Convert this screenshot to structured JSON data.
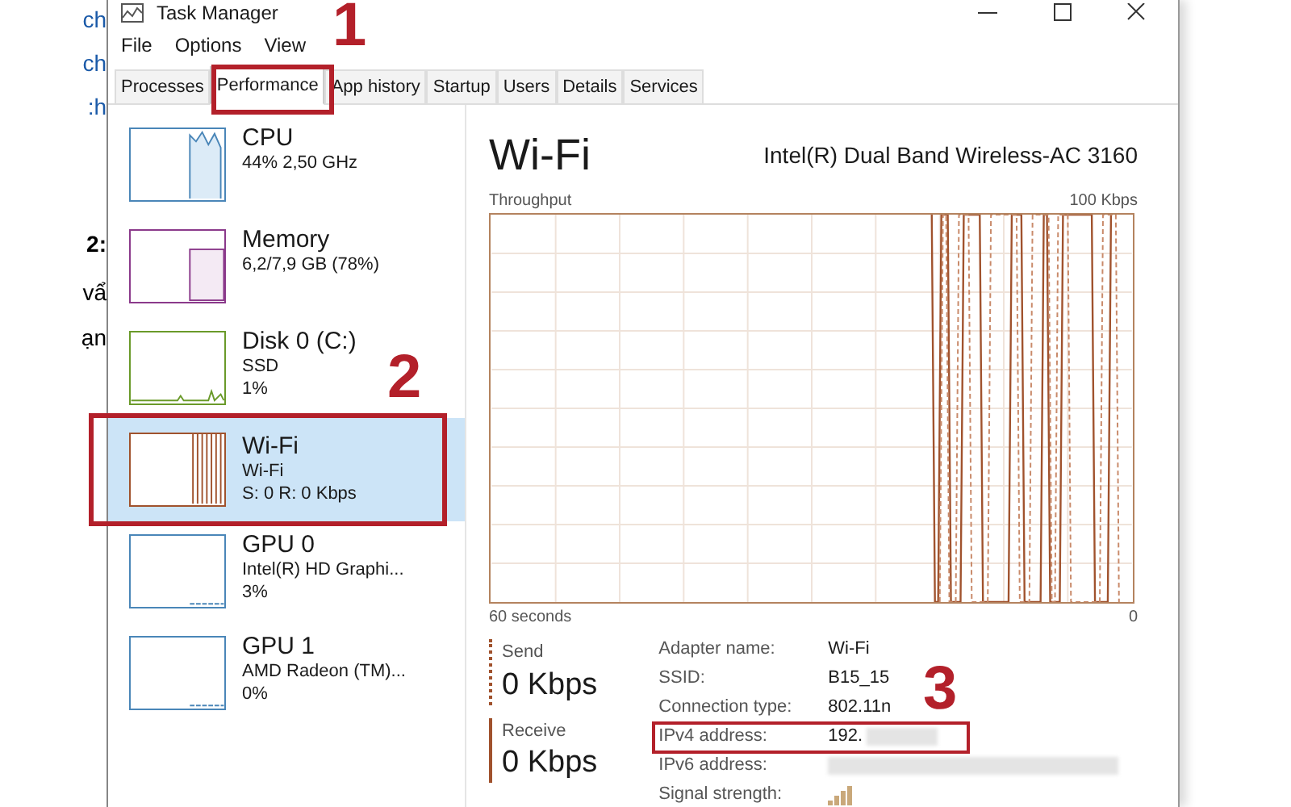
{
  "background_page": {
    "fragments": [
      "ch",
      "ch",
      ":h",
      "2:",
      "vẩ",
      "ạn"
    ]
  },
  "window": {
    "title": "Task Manager"
  },
  "menu": [
    "File",
    "Options",
    "View"
  ],
  "tabs": [
    {
      "label": "Processes",
      "selected": false
    },
    {
      "label": "Performance",
      "selected": true
    },
    {
      "label": "App history",
      "selected": false
    },
    {
      "label": "Startup",
      "selected": false
    },
    {
      "label": "Users",
      "selected": false
    },
    {
      "label": "Details",
      "selected": false
    },
    {
      "label": "Services",
      "selected": false
    }
  ],
  "sidebar": {
    "items": [
      {
        "kind": "cpu",
        "name": "CPU",
        "lines": [
          "44% 2,50 GHz"
        ],
        "color": "#4a86b8",
        "selected": false
      },
      {
        "kind": "memory",
        "name": "Memory",
        "lines": [
          "6,2/7,9 GB (78%)"
        ],
        "color": "#8b3a8b",
        "selected": false
      },
      {
        "kind": "disk",
        "name": "Disk 0 (C:)",
        "lines": [
          "SSD",
          "1%"
        ],
        "color": "#6a9a2a",
        "selected": false
      },
      {
        "kind": "network",
        "name": "Wi-Fi",
        "lines": [
          "Wi-Fi",
          "S: 0 R: 0 Kbps"
        ],
        "color": "#a0522d",
        "selected": true
      },
      {
        "kind": "gpu",
        "name": "GPU 0",
        "lines": [
          "Intel(R) HD Graphi...",
          "3%"
        ],
        "color": "#4a86b8",
        "selected": false
      },
      {
        "kind": "gpu",
        "name": "GPU 1",
        "lines": [
          "AMD Radeon (TM)...",
          "0%"
        ],
        "color": "#4a86b8",
        "selected": false
      }
    ]
  },
  "detail": {
    "title": "Wi-Fi",
    "adapter": "Intel(R) Dual Band Wireless-AC 3160",
    "chart_label": "Throughput",
    "chart_max": "100 Kbps",
    "time_span": "60 seconds",
    "chart_min": "0",
    "stats": [
      {
        "kind": "send",
        "label": "Send",
        "value": "0 Kbps"
      },
      {
        "kind": "receive",
        "label": "Receive",
        "value": "0 Kbps"
      }
    ],
    "properties": [
      {
        "label": "Adapter name:",
        "value": "Wi-Fi",
        "redacted": false
      },
      {
        "label": "SSID:",
        "value": "B15_15",
        "redacted": false
      },
      {
        "label": "Connection type:",
        "value": "802.11n",
        "redacted": false
      },
      {
        "label": "IPv4 address:",
        "value": "192.",
        "redacted": true
      },
      {
        "label": "IPv6 address:",
        "redacted": true
      },
      {
        "label": "Signal strength:",
        "kind": "signal"
      }
    ]
  },
  "annotations": [
    {
      "label": "1"
    },
    {
      "label": "2"
    },
    {
      "label": "3"
    }
  ]
}
